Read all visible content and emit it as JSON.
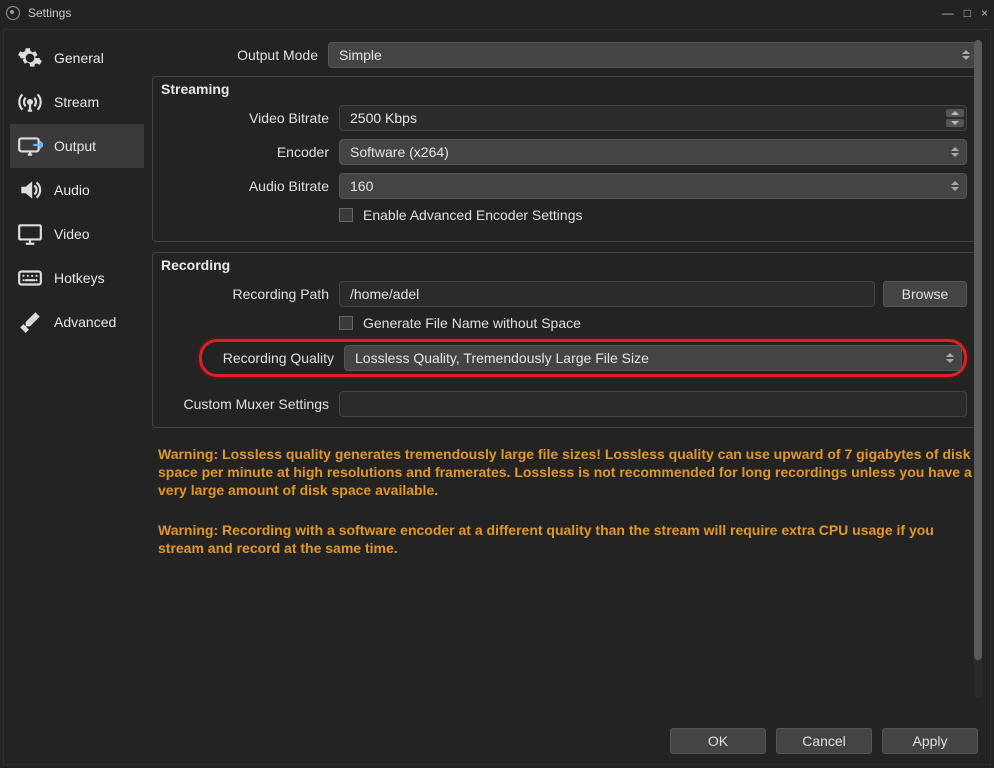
{
  "window": {
    "title": "Settings",
    "btn_min": "—",
    "btn_max": "□",
    "btn_close": "×"
  },
  "sidebar": {
    "items": [
      {
        "label": "General"
      },
      {
        "label": "Stream"
      },
      {
        "label": "Output"
      },
      {
        "label": "Audio"
      },
      {
        "label": "Video"
      },
      {
        "label": "Hotkeys"
      },
      {
        "label": "Advanced"
      }
    ]
  },
  "output_mode": {
    "label": "Output Mode",
    "value": "Simple"
  },
  "streaming": {
    "legend": "Streaming",
    "video_bitrate": {
      "label": "Video Bitrate",
      "value": "2500 Kbps"
    },
    "encoder": {
      "label": "Encoder",
      "value": "Software (x264)"
    },
    "audio_bitrate": {
      "label": "Audio Bitrate",
      "value": "160"
    },
    "enable_advanced": {
      "label": "Enable Advanced Encoder Settings"
    }
  },
  "recording": {
    "legend": "Recording",
    "path": {
      "label": "Recording Path",
      "value": "/home/adel",
      "browse": "Browse"
    },
    "no_space": {
      "label": "Generate File Name without Space"
    },
    "quality": {
      "label": "Recording Quality",
      "value": "Lossless Quality, Tremendously Large File Size"
    },
    "muxer": {
      "label": "Custom Muxer Settings",
      "value": ""
    }
  },
  "warnings": {
    "w1": "Warning: Lossless quality generates tremendously large file sizes! Lossless quality can use upward of 7 gigabytes of disk space per minute at high resolutions and framerates. Lossless is not recommended for long recordings unless you have a very large amount of disk space available.",
    "w2": "Warning: Recording with a software encoder at a different quality than the stream will require extra CPU usage if you stream and record at the same time."
  },
  "footer": {
    "ok": "OK",
    "cancel": "Cancel",
    "apply": "Apply"
  }
}
